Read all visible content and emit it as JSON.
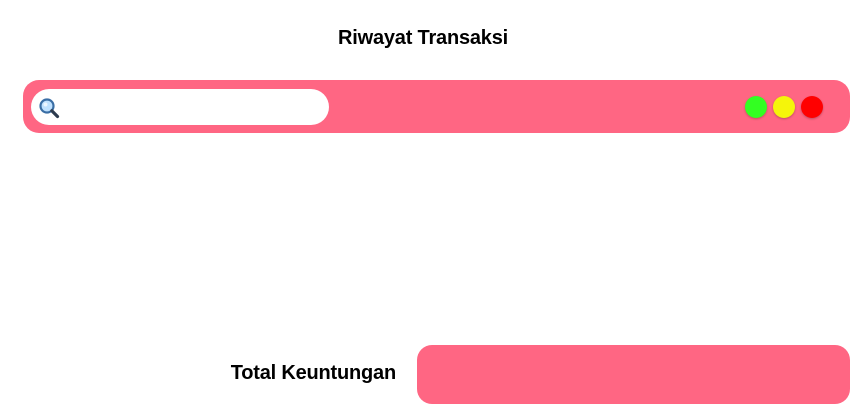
{
  "header": {
    "title": "Riwayat Transaksi"
  },
  "toolbar": {
    "search": {
      "placeholder": "",
      "value": "",
      "icon": "magnifying-glass"
    },
    "window_controls": [
      {
        "name": "green",
        "color": "#33ff22"
      },
      {
        "name": "yellow",
        "color": "#f5f50a"
      },
      {
        "name": "red",
        "color": "#ff0000"
      }
    ]
  },
  "footer": {
    "total_label": "Total Keuntungan",
    "total_value": ""
  },
  "colors": {
    "accent": "#ff6683",
    "background": "#ffffff",
    "text": "#000000"
  }
}
